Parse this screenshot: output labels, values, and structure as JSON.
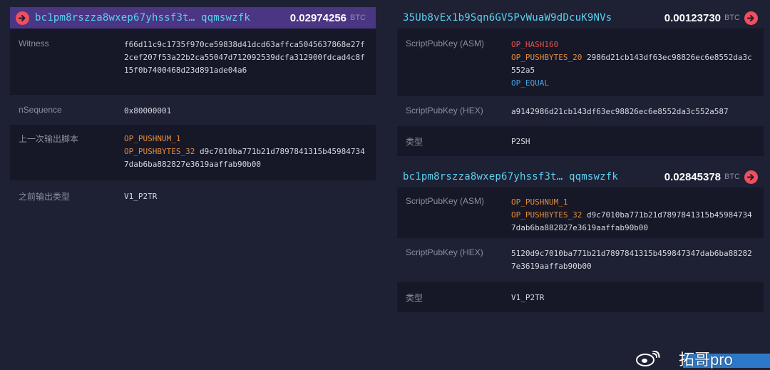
{
  "inputs": {
    "header": {
      "address": "bc1pm8rszza8wxep67yhssf3t… qqmswzfk",
      "amount": "0.02974256",
      "unit": "BTC"
    },
    "witness": {
      "label": "Witness",
      "value": "f66d11c9c1735f970ce59838d41dcd63affca5045637868e27f2cef207f53a22b2ca55047d712092539dcfa312900fdcad4c8f15f0b7400468d23d891ade04a6"
    },
    "nsequence": {
      "label": "nSequence",
      "value": "0x80000001"
    },
    "prev_script": {
      "label": "上一次输出脚本",
      "op1": "OP_PUSHNUM_1",
      "op2": "OP_PUSHBYTES_32",
      "data": "d9c7010ba771b21d7897841315b459847347dab6ba882827e3619aaffab90b00"
    },
    "prev_type": {
      "label": "之前输出类型",
      "value": "V1_P2TR"
    }
  },
  "outputs": [
    {
      "header": {
        "address": "35Ub8vEx1b9Sqn6GV5PvWuaW9dDcuK9NVs",
        "amount": "0.00123730",
        "unit": "BTC"
      },
      "asm": {
        "label": "ScriptPubKey (ASM)",
        "op1": "OP_HASH160",
        "op2": "OP_PUSHBYTES_20",
        "data": "2986d21cb143df63ec98826ec6e8552da3c552a5",
        "op3": "OP_EQUAL"
      },
      "hex": {
        "label": "ScriptPubKey (HEX)",
        "value": "a9142986d21cb143df63ec98826ec6e8552da3c552a587"
      },
      "type": {
        "label": "类型",
        "value": "P2SH"
      }
    },
    {
      "header": {
        "address": "bc1pm8rszza8wxep67yhssf3t… qqmswzfk",
        "amount": "0.02845378",
        "unit": "BTC"
      },
      "asm": {
        "label": "ScriptPubKey (ASM)",
        "op1": "OP_PUSHNUM_1",
        "op2": "OP_PUSHBYTES_32",
        "data": "d9c7010ba771b21d7897841315b459847347dab6ba882827e3619aaffab90b00"
      },
      "hex": {
        "label": "ScriptPubKey (HEX)",
        "value": "5120d9c7010ba771b21d7897841315b459847347dab6ba882827e3619aaffab90b00"
      },
      "type": {
        "label": "类型",
        "value": "V1_P2TR"
      }
    }
  ],
  "watermark": {
    "text": "拓哥pro"
  },
  "colors": {
    "background": "#1e2034",
    "row_dark": "#161827",
    "active_header": "#4a3683",
    "address": "#5bd1f0",
    "arrow": "#ef4f5f",
    "op_red": "#e0524f",
    "op_orange": "#e38a3a",
    "op_blue": "#47a3e0"
  },
  "icons": [
    "arrow-right-circle-icon",
    "weibo-icon"
  ]
}
